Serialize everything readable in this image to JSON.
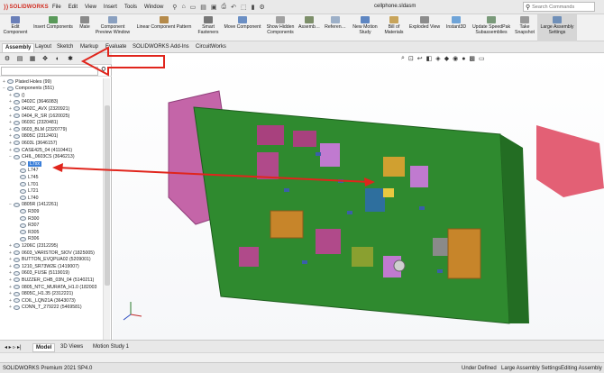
{
  "app": {
    "brand": "SOLIDWORKS",
    "filename": "cellphone.sldasm"
  },
  "menu": [
    "File",
    "Edit",
    "View",
    "Insert",
    "Tools",
    "Window"
  ],
  "search": {
    "placeholder": "Search Commands"
  },
  "ribbon": [
    {
      "label": "Edit\nComponent",
      "icon": "edit-component-icon"
    },
    {
      "label": "Insert Components",
      "icon": "insert-components-icon"
    },
    {
      "label": "Mate",
      "icon": "mate-icon"
    },
    {
      "label": "Component\nPreview Window",
      "icon": "component-preview-icon"
    },
    {
      "label": "Linear Component Pattern",
      "icon": "linear-pattern-icon"
    },
    {
      "label": "Smart\nFasteners",
      "icon": "smart-fasteners-icon"
    },
    {
      "label": "Move Component",
      "icon": "move-component-icon"
    },
    {
      "label": "Show Hidden\nComponents",
      "icon": "show-hidden-icon"
    },
    {
      "label": "Assemb…",
      "icon": "assembly-features-icon"
    },
    {
      "label": "Referen…",
      "icon": "reference-geometry-icon"
    },
    {
      "label": "New Motion\nStudy",
      "icon": "motion-study-icon"
    },
    {
      "label": "Bill of\nMaterials",
      "icon": "bom-icon"
    },
    {
      "label": "Exploded View",
      "icon": "exploded-view-icon"
    },
    {
      "label": "Instant3D",
      "icon": "instant3d-icon"
    },
    {
      "label": "Update SpeedPak\nSubassemblies",
      "icon": "speedpak-icon"
    },
    {
      "label": "Take\nSnapshot",
      "icon": "snapshot-icon"
    },
    {
      "label": "Large Assembly\nSettings",
      "icon": "large-assembly-icon"
    }
  ],
  "command_tabs": [
    "Assembly",
    "Layout",
    "Sketch",
    "Markup",
    "Evaluate",
    "SOLIDWORKS Add-Ins",
    "CircuitWorks"
  ],
  "tree": [
    {
      "label": "Plated Holes (99)",
      "level": 0,
      "toggle": "+"
    },
    {
      "label": "Components (551)",
      "level": 0,
      "toggle": "−"
    },
    {
      "label": "()",
      "level": 1,
      "toggle": "+"
    },
    {
      "label": "0402C (3646083)",
      "level": 1,
      "toggle": "+"
    },
    {
      "label": "0402C_AVX (2320921)",
      "level": 1,
      "toggle": "+"
    },
    {
      "label": "0404_R_SR (1620025)",
      "level": 1,
      "toggle": "+"
    },
    {
      "label": "0603C (2320481)",
      "level": 1,
      "toggle": "+"
    },
    {
      "label": "0603_BLM (2320779)",
      "level": 1,
      "toggle": "+"
    },
    {
      "label": "0805C (2312401)",
      "level": 1,
      "toggle": "+"
    },
    {
      "label": "0603L (3646157)",
      "level": 1,
      "toggle": "+"
    },
    {
      "label": "CASE425_04 (4110441)",
      "level": 1,
      "toggle": "+"
    },
    {
      "label": "CHIL_0603CS (3646213)",
      "level": 1,
      "toggle": "−"
    },
    {
      "label": "L7xx",
      "level": 2,
      "toggle": "",
      "selected": true
    },
    {
      "label": "L747",
      "level": 2,
      "toggle": ""
    },
    {
      "label": "L745",
      "level": 2,
      "toggle": ""
    },
    {
      "label": "L701",
      "level": 2,
      "toggle": ""
    },
    {
      "label": "L721",
      "level": 2,
      "toggle": ""
    },
    {
      "label": "L740",
      "level": 2,
      "toggle": ""
    },
    {
      "label": "0805R (1412261)",
      "level": 1,
      "toggle": "−"
    },
    {
      "label": "R309",
      "level": 2,
      "toggle": ""
    },
    {
      "label": "R300",
      "level": 2,
      "toggle": ""
    },
    {
      "label": "R307",
      "level": 2,
      "toggle": ""
    },
    {
      "label": "R305",
      "level": 2,
      "toggle": ""
    },
    {
      "label": "R306",
      "level": 2,
      "toggle": ""
    },
    {
      "label": "1206C (2312295)",
      "level": 1,
      "toggle": "+"
    },
    {
      "label": "0603_VARISTOR_SIOV (1825005)",
      "level": 1,
      "toggle": "+"
    },
    {
      "label": "BUTTON_EVQPUA02 (5209001)",
      "level": 1,
      "toggle": "+"
    },
    {
      "label": "1210_SR73W2E (1419007)",
      "level": 1,
      "toggle": "+"
    },
    {
      "label": "0603_FUSE (5119019)",
      "level": 1,
      "toggle": "+"
    },
    {
      "label": "BUZZER_CHB_03N_04 (5140211)",
      "level": 1,
      "toggle": "+"
    },
    {
      "label": "0805_NTC_MURATA_H1.0 (182003",
      "level": 1,
      "toggle": "+"
    },
    {
      "label": "0805C_H1.35 (2312221)",
      "level": 1,
      "toggle": "+"
    },
    {
      "label": "COIL_LQN21A (3643073)",
      "level": 1,
      "toggle": "+"
    },
    {
      "label": "CONN_T_279222 (5469581)",
      "level": 1,
      "toggle": "+"
    }
  ],
  "bottom_tabs": [
    "Model",
    "3D Views",
    "Motion Study 1"
  ],
  "status": {
    "version": "SOLIDWORKS Premium 2021 SP4.0",
    "state": "Under Defined",
    "settings": "Large Assembly Settings",
    "editing": "Editing Assembly"
  },
  "colors": {
    "board": "#2f8a2f",
    "accent": "#d12b1f",
    "annotation": "#e0251c",
    "selection": "#3b7fd9"
  }
}
